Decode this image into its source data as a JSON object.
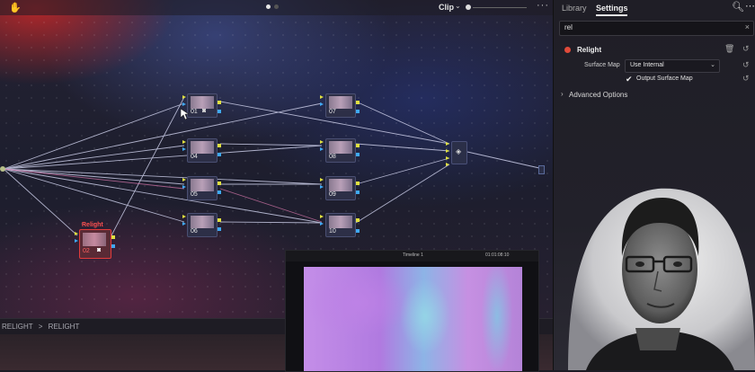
{
  "toolbar": {
    "hand_icon": "hand-icon",
    "clip_label": "Clip",
    "more_icon": "ellipsis-icon"
  },
  "node_editor": {
    "nodes": [
      {
        "id": "01"
      },
      {
        "id": "04"
      },
      {
        "id": "05"
      },
      {
        "id": "06"
      },
      {
        "id": "07"
      },
      {
        "id": "08"
      },
      {
        "id": "09"
      },
      {
        "id": "10"
      }
    ],
    "relight_node": {
      "title": "Relight",
      "id": "02"
    },
    "breadcrumb": [
      "RELIGHT",
      "RELIGHT"
    ],
    "breadcrumb_separator": ">",
    "colors": {
      "accent_red": "#e23b3b",
      "port_yellow": "#e0e040",
      "port_blue": "#3fa9f5"
    }
  },
  "panel": {
    "tabs": [
      {
        "label": "Library"
      },
      {
        "label": "Settings",
        "active": true
      }
    ],
    "search_value": "rel",
    "effect_name": "Relight",
    "surface_map_label": "Surface Map",
    "surface_map_value": "Use Internal",
    "output_surface_map_label": "Output Surface Map",
    "output_surface_map_checked": true,
    "advanced_options_label": "Advanced Options"
  },
  "viewer": {
    "title": "Timeline 1",
    "timecode": "01:01:08:10"
  }
}
